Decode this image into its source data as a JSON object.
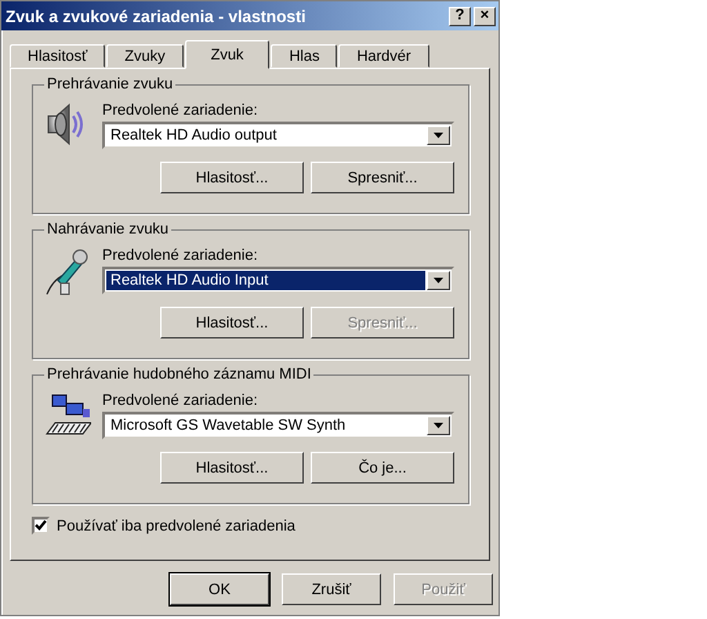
{
  "window": {
    "title": "Zvuk a zvukové zariadenia - vlastnosti",
    "buttons": [
      "?",
      "×"
    ]
  },
  "tabs": [
    {
      "label": "Hlasitosť",
      "selected": false
    },
    {
      "label": "Zvuky",
      "selected": false
    },
    {
      "label": "Zvuk",
      "selected": true
    },
    {
      "label": "Hlas",
      "selected": false
    },
    {
      "label": "Hardvér",
      "selected": false
    }
  ],
  "groups": [
    {
      "title": "Prehrávanie zvuku",
      "kind": "speaker",
      "label": "Predvolené zariadenie:",
      "device": {
        "value": "Realtek HD Audio output",
        "selected": false
      },
      "buttons": [
        {
          "label": "Hlasitosť...",
          "disabled": false
        },
        {
          "label": "Spresniť...",
          "disabled": false
        }
      ]
    },
    {
      "title": "Nahrávanie zvuku",
      "kind": "microphone",
      "label": "Predvolené zariadenie:",
      "device": {
        "value": "Realtek HD Audio Input",
        "selected": true
      },
      "buttons": [
        {
          "label": "Hlasitosť...",
          "disabled": false
        },
        {
          "label": "Spresniť...",
          "disabled": true
        }
      ]
    },
    {
      "title": "Prehrávanie hudobného záznamu MIDI",
      "kind": "midi",
      "label": "Predvolené zariadenie:",
      "device": {
        "value": "Microsoft GS Wavetable SW Synth",
        "selected": false
      },
      "buttons": [
        {
          "label": "Hlasitosť...",
          "disabled": false
        },
        {
          "label": "Čo je...",
          "disabled": false
        }
      ]
    }
  ],
  "checkbox": {
    "label": "Používať iba predvolené zariadenia",
    "checked": true
  },
  "buttons": [
    {
      "label": "OK",
      "disabled": false,
      "default": true
    },
    {
      "label": "Zrušiť",
      "disabled": false,
      "default": false
    },
    {
      "label": "Použiť",
      "disabled": true,
      "default": false
    }
  ]
}
